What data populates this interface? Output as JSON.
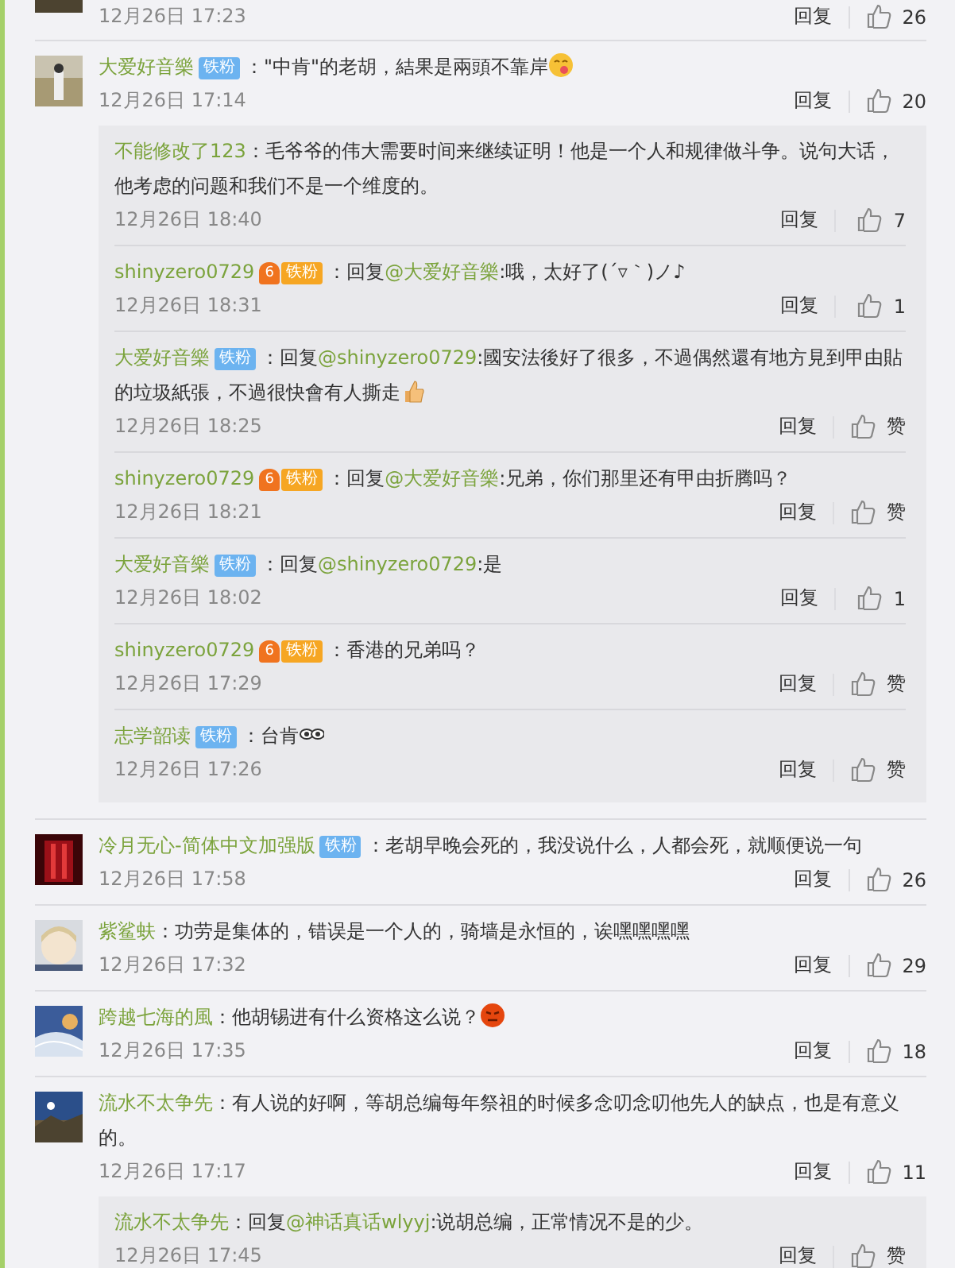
{
  "comments": [
    {
      "date": "12月26日 17:23",
      "reply_label": "回复",
      "likes": "26"
    },
    {
      "user": "大爱好音樂",
      "badge": {
        "kind": "plain",
        "label": "铁粉"
      },
      "text": [
        {
          "kind": "plain",
          "text": "：\"中肯\"的老胡，結果是兩頭不靠岸"
        },
        {
          "kind": "emoji-drool"
        }
      ],
      "date": "12月26日 17:14",
      "reply_label": "回复",
      "likes": "20",
      "replies": [
        {
          "user": "不能修改了123",
          "text": [
            {
              "kind": "plain",
              "text": "：毛爷爷的伟大需要时间来继续证明！他是一个人和规律做斗争。说句大话，他考虑的问题和我们不是一个维度的。"
            }
          ],
          "date": "12月26日 18:40",
          "reply_label": "回复",
          "likes": "7"
        },
        {
          "user": "shinyzero0729",
          "badge": {
            "kind": "level",
            "level": "6",
            "label": "铁粉"
          },
          "text": [
            {
              "kind": "plain",
              "text": "：回复"
            },
            {
              "kind": "mention",
              "text": "@大爱好音樂"
            },
            {
              "kind": "plain",
              "text": ":哦，太好了(´▿｀)ノ♪"
            }
          ],
          "date": "12月26日 18:31",
          "reply_label": "回复",
          "likes": "1"
        },
        {
          "user": "大爱好音樂",
          "badge": {
            "kind": "plain",
            "label": "铁粉"
          },
          "text": [
            {
              "kind": "plain",
              "text": "：回复"
            },
            {
              "kind": "mention",
              "text": "@shinyzero0729"
            },
            {
              "kind": "plain",
              "text": ":國安法後好了很多，不過偶然還有地方見到甲由貼的垃圾紙張，不過很快會有人撕走"
            },
            {
              "kind": "emoji-thumb"
            }
          ],
          "date": "12月26日 18:25",
          "reply_label": "回复",
          "likes": "赞"
        },
        {
          "user": "shinyzero0729",
          "badge": {
            "kind": "level",
            "level": "6",
            "label": "铁粉"
          },
          "text": [
            {
              "kind": "plain",
              "text": "：回复"
            },
            {
              "kind": "mention",
              "text": "@大爱好音樂"
            },
            {
              "kind": "plain",
              "text": ":兄弟，你们那里还有甲由折腾吗？"
            }
          ],
          "date": "12月26日 18:21",
          "reply_label": "回复",
          "likes": "赞"
        },
        {
          "user": "大爱好音樂",
          "badge": {
            "kind": "plain",
            "label": "铁粉"
          },
          "text": [
            {
              "kind": "plain",
              "text": "：回复"
            },
            {
              "kind": "mention",
              "text": "@shinyzero0729"
            },
            {
              "kind": "plain",
              "text": ":是"
            }
          ],
          "date": "12月26日 18:02",
          "reply_label": "回复",
          "likes": "1"
        },
        {
          "user": "shinyzero0729",
          "badge": {
            "kind": "level",
            "level": "6",
            "label": "铁粉"
          },
          "text": [
            {
              "kind": "plain",
              "text": "：香港的兄弟吗？"
            }
          ],
          "date": "12月26日 17:29",
          "reply_label": "回复",
          "likes": "赞"
        },
        {
          "user": "志学韶读",
          "badge": {
            "kind": "plain",
            "label": "铁粉"
          },
          "text": [
            {
              "kind": "plain",
              "text": "：台肯"
            },
            {
              "kind": "emoji-eyes"
            }
          ],
          "date": "12月26日 17:26",
          "reply_label": "回复",
          "likes": "赞"
        }
      ]
    },
    {
      "user": "冷月无心-简体中文加强版",
      "badge": {
        "kind": "plain",
        "label": "铁粉"
      },
      "text": [
        {
          "kind": "plain",
          "text": "：老胡早晚会死的，我没说什么，人都会死，就顺便说一句"
        }
      ],
      "date": "12月26日 17:58",
      "reply_label": "回复",
      "likes": "26"
    },
    {
      "user": "紫鲨蚨",
      "text": [
        {
          "kind": "plain",
          "text": "：功劳是集体的，错误是一个人的，骑墙是永恒的，诶嘿嘿嘿嘿"
        }
      ],
      "date": "12月26日 17:32",
      "reply_label": "回复",
      "likes": "29"
    },
    {
      "user": "跨越七海的風",
      "text": [
        {
          "kind": "plain",
          "text": "：他胡锡进有什么资格这么说？"
        },
        {
          "kind": "emoji-angry"
        }
      ],
      "date": "12月26日 17:35",
      "reply_label": "回复",
      "likes": "18"
    },
    {
      "user": "流水不太争先",
      "text": [
        {
          "kind": "plain",
          "text": "：有人说的好啊，等胡总编每年祭祖的时候多念叨念叨他先人的缺点，也是有意义的。"
        }
      ],
      "date": "12月26日 17:17",
      "reply_label": "回复",
      "likes": "11",
      "replies": [
        {
          "user": "流水不太争先",
          "text": [
            {
              "kind": "plain",
              "text": "：回复"
            },
            {
              "kind": "mention",
              "text": "@神话真话wlyyj"
            },
            {
              "kind": "plain",
              "text": ":说胡总编，正常情况不是的少。"
            }
          ],
          "date": "12月26日 17:45",
          "reply_label": "回复",
          "likes": "赞"
        }
      ]
    }
  ]
}
